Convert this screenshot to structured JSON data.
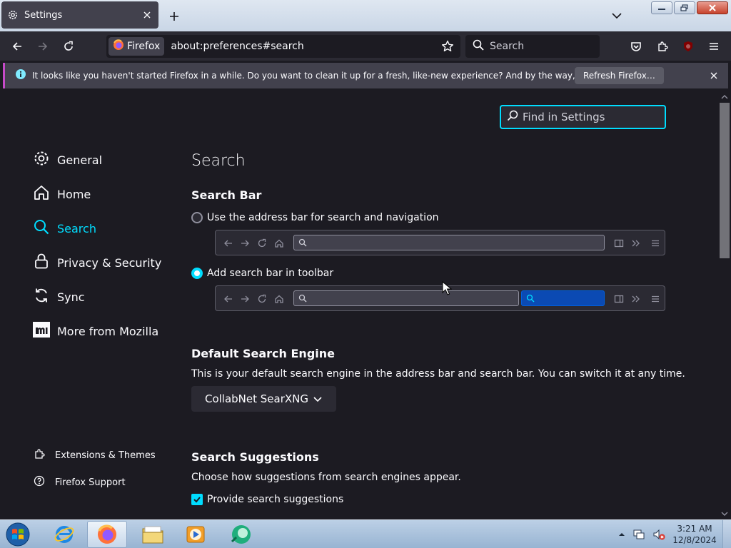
{
  "tab": {
    "title": "Settings",
    "icon": "gear-icon"
  },
  "nav": {
    "identity_label": "Firefox",
    "url": "about:preferences#search",
    "search_placeholder": "Search"
  },
  "notification": {
    "message": "It looks like you haven't started Firefox in a while. Do you want to clean it up for a fresh, like-new experience? And by the way, welcome back!",
    "button_label": "Refresh Firefox…"
  },
  "find": {
    "placeholder": "Find in Settings"
  },
  "sidebar": {
    "items": [
      {
        "label": "General",
        "icon": "gear-icon"
      },
      {
        "label": "Home",
        "icon": "home-icon"
      },
      {
        "label": "Search",
        "icon": "search-icon",
        "selected": true
      },
      {
        "label": "Privacy & Security",
        "icon": "lock-icon"
      },
      {
        "label": "Sync",
        "icon": "sync-icon"
      },
      {
        "label": "More from Mozilla",
        "icon": "mozilla-icon"
      }
    ],
    "footer": [
      {
        "label": "Extensions & Themes",
        "icon": "puzzle-icon"
      },
      {
        "label": "Firefox Support",
        "icon": "help-icon"
      }
    ]
  },
  "main": {
    "title": "Search",
    "search_bar": {
      "heading": "Search Bar",
      "option_address": "Use the address bar for search and navigation",
      "option_toolbar": "Add search bar in toolbar",
      "selected": "toolbar"
    },
    "default_engine": {
      "heading": "Default Search Engine",
      "description": "This is your default search engine in the address bar and search bar. You can switch it at any time.",
      "selected": "CollabNet SearXNG"
    },
    "suggestions": {
      "heading": "Search Suggestions",
      "description": "Choose how suggestions from search engines appear.",
      "checkbox_label": "Provide search suggestions",
      "checked": true
    }
  },
  "taskbar": {
    "time": "3:21 AM",
    "date": "12/8/2024"
  },
  "colors": {
    "accent": "#00ddff",
    "background": "#1c1b22",
    "toolbar": "#2b2a33"
  }
}
